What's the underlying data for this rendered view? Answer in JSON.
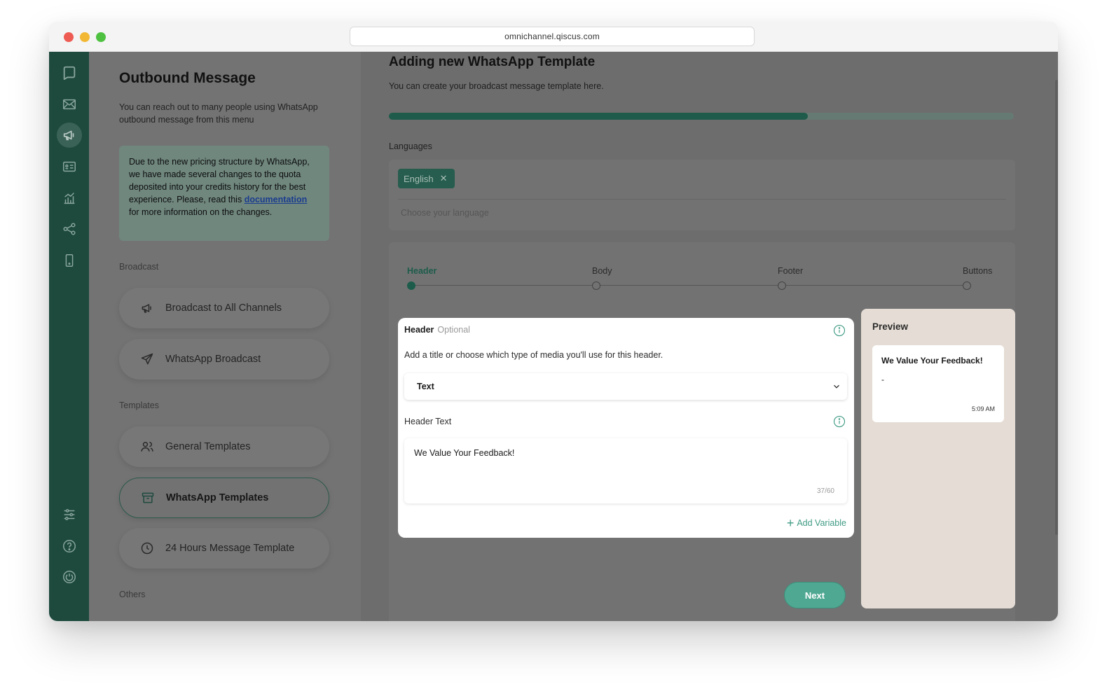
{
  "browser": {
    "url": "omnichannel.qiscus.com"
  },
  "rail": {
    "icons": [
      "chat-bubble-icon",
      "inbox-icon",
      "megaphone-icon",
      "contacts-icon",
      "analytics-icon",
      "integrations-icon",
      "mobile-icon",
      "settings-sliders-icon",
      "help-icon",
      "power-icon"
    ]
  },
  "sidebar": {
    "title": "Outbound Message",
    "subtitle": "You can reach out to many people using WhatsApp outbound message from this menu",
    "notice": {
      "before": "Due to the new pricing structure by WhatsApp, we have made several changes to the quota deposited into your credits history for the best experience. Please, read this ",
      "link": "documentation",
      "after": " for more information on the changes."
    },
    "sections": {
      "broadcast": "Broadcast",
      "templates": "Templates",
      "others": "Others"
    },
    "items": [
      {
        "label": "Broadcast to All Channels",
        "icon": "megaphone-icon"
      },
      {
        "label": "WhatsApp Broadcast",
        "icon": "send-icon"
      },
      {
        "label": "General Templates",
        "icon": "users-icon"
      },
      {
        "label": "WhatsApp Templates",
        "icon": "archive-icon",
        "selected": true
      },
      {
        "label": "24 Hours Message Template",
        "icon": "clock-icon"
      }
    ]
  },
  "main": {
    "title": "Adding new WhatsApp Template",
    "subtitle": "You can create your broadcast message template here.",
    "progress_fraction": 0.67,
    "languages": {
      "label": "Languages",
      "chips": [
        "English"
      ],
      "placeholder": "Choose your language"
    },
    "steps": [
      "Header",
      "Body",
      "Footer",
      "Buttons"
    ],
    "active_step": 0,
    "header_card": {
      "title": "Header",
      "optional": "Optional",
      "description": "Add a title or choose which type of media you'll use for this header.",
      "type_selected": "Text",
      "text_label": "Header Text",
      "text_value": "We Value Your Feedback!",
      "counter": "37/60",
      "add_variable": "Add Variable"
    },
    "next_label": "Next"
  },
  "preview": {
    "title": "Preview",
    "bubble_title": "We Value Your Feedback!",
    "bubble_body": "-",
    "time": "5:09 AM"
  },
  "colors": {
    "rail": "#1e4a3e",
    "accent": "#3f9b84",
    "preview_bg": "#e5ddd5"
  }
}
